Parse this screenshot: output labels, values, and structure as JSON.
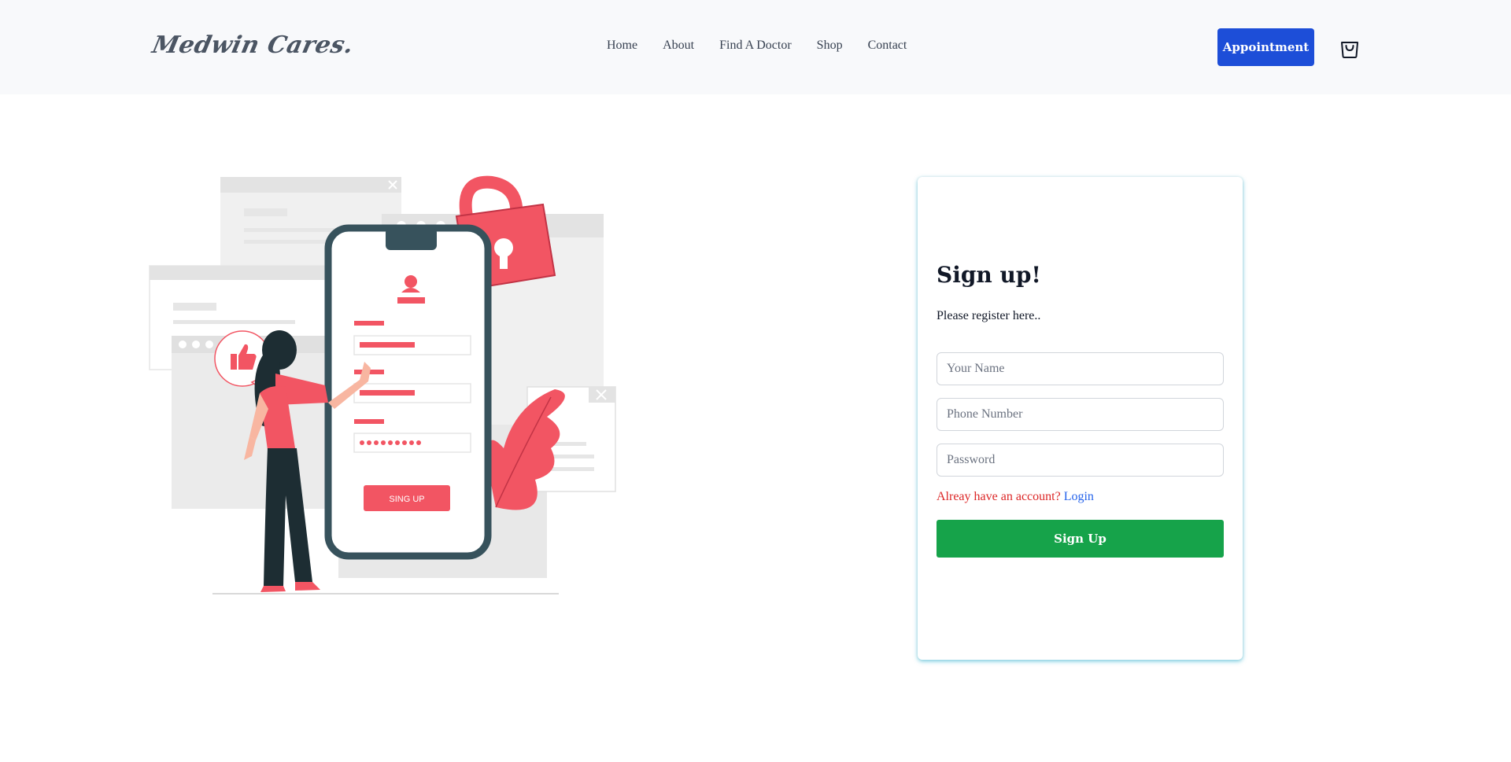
{
  "header": {
    "logo": "Medwin Cares.",
    "nav": [
      "Home",
      "About",
      "Find A Doctor",
      "Shop",
      "Contact"
    ],
    "appointment_label": "Appointment",
    "cart_icon": "shopping-bag-icon"
  },
  "illustration": {
    "phone_button_label": "SING UP"
  },
  "signup": {
    "title": "Sign up!",
    "subtitle": "Please register here..",
    "name_placeholder": "Your Name",
    "phone_placeholder": "Phone Number",
    "password_placeholder": "Password",
    "account_text": "Alreay have an account?",
    "login_label": "Login",
    "submit_label": "Sign Up"
  },
  "colors": {
    "accent_blue": "#1d4ed8",
    "submit_green": "#16a34a",
    "illustration_red": "#f25563",
    "link_blue": "#2563eb",
    "warning_red": "#dc2626"
  }
}
